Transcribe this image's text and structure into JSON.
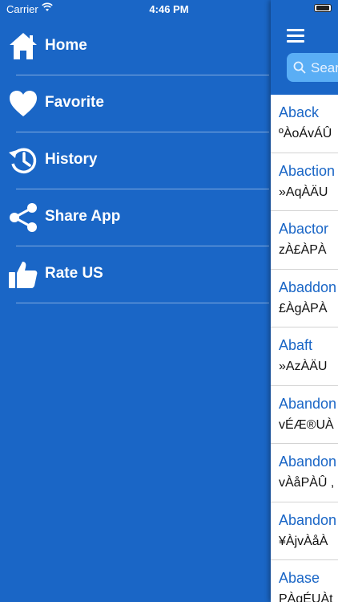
{
  "status": {
    "carrier": "Carrier",
    "time": "4:46 PM"
  },
  "menu": [
    {
      "label": "Home",
      "icon": "home-icon"
    },
    {
      "label": "Favorite",
      "icon": "heart-icon"
    },
    {
      "label": "History",
      "icon": "history-icon"
    },
    {
      "label": "Share App",
      "icon": "share-icon"
    },
    {
      "label": "Rate US",
      "icon": "thumbs-up-icon"
    }
  ],
  "search": {
    "placeholder": "Search"
  },
  "words": [
    {
      "word": "Aback",
      "meaning": "ºÀoÁvÁÛ"
    },
    {
      "word": "Abaction",
      "meaning": "»AqÀÄU"
    },
    {
      "word": "Abactor",
      "meaning": "zÀ£ÀPÀ"
    },
    {
      "word": "Abaddon",
      "meaning": "£ÀgÀPÀ"
    },
    {
      "word": "Abaft",
      "meaning": "»AzÀÄU"
    },
    {
      "word": "Abandon",
      "meaning": "vÉÆ®UÀ"
    },
    {
      "word": "Abandon",
      "meaning": "vÀåPÀÛ ,"
    },
    {
      "word": "Abandon",
      "meaning": "¥ÀjvÀåÀ"
    },
    {
      "word": "Abase",
      "meaning": "PÀqÉUÀt"
    }
  ],
  "colors": {
    "primary": "#1a66c6",
    "search_bg": "#5aaef5",
    "link": "#1a66c6"
  }
}
